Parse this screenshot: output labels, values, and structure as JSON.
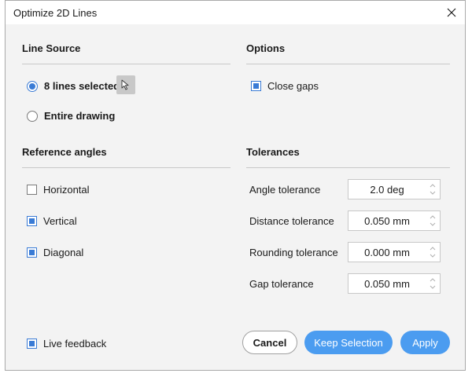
{
  "window": {
    "title": "Optimize 2D Lines"
  },
  "line_source": {
    "title": "Line Source",
    "options": [
      {
        "label": "8 lines selected",
        "selected": true
      },
      {
        "label": "Entire drawing",
        "selected": false
      }
    ],
    "pick_icon": "cursor-arrow-icon"
  },
  "options": {
    "title": "Options",
    "close_gaps": {
      "label": "Close gaps",
      "checked": true
    }
  },
  "reference_angles": {
    "title": "Reference angles",
    "items": [
      {
        "label": "Horizontal",
        "checked": false
      },
      {
        "label": "Vertical",
        "checked": true
      },
      {
        "label": "Diagonal",
        "checked": true
      }
    ]
  },
  "tolerances": {
    "title": "Tolerances",
    "rows": [
      {
        "label": "Angle tolerance",
        "value": "2.0 deg"
      },
      {
        "label": "Distance tolerance",
        "value": "0.050 mm"
      },
      {
        "label": "Rounding tolerance",
        "value": "0.000 mm"
      },
      {
        "label": "Gap tolerance",
        "value": "0.050 mm"
      }
    ]
  },
  "footer": {
    "live_feedback": {
      "label": "Live feedback",
      "checked": true
    },
    "cancel_label": "Cancel",
    "keep_selection_label": "Keep Selection",
    "apply_label": "Apply"
  },
  "colors": {
    "accent": "#3a7bd5",
    "primary_button": "#4b9cf0"
  }
}
